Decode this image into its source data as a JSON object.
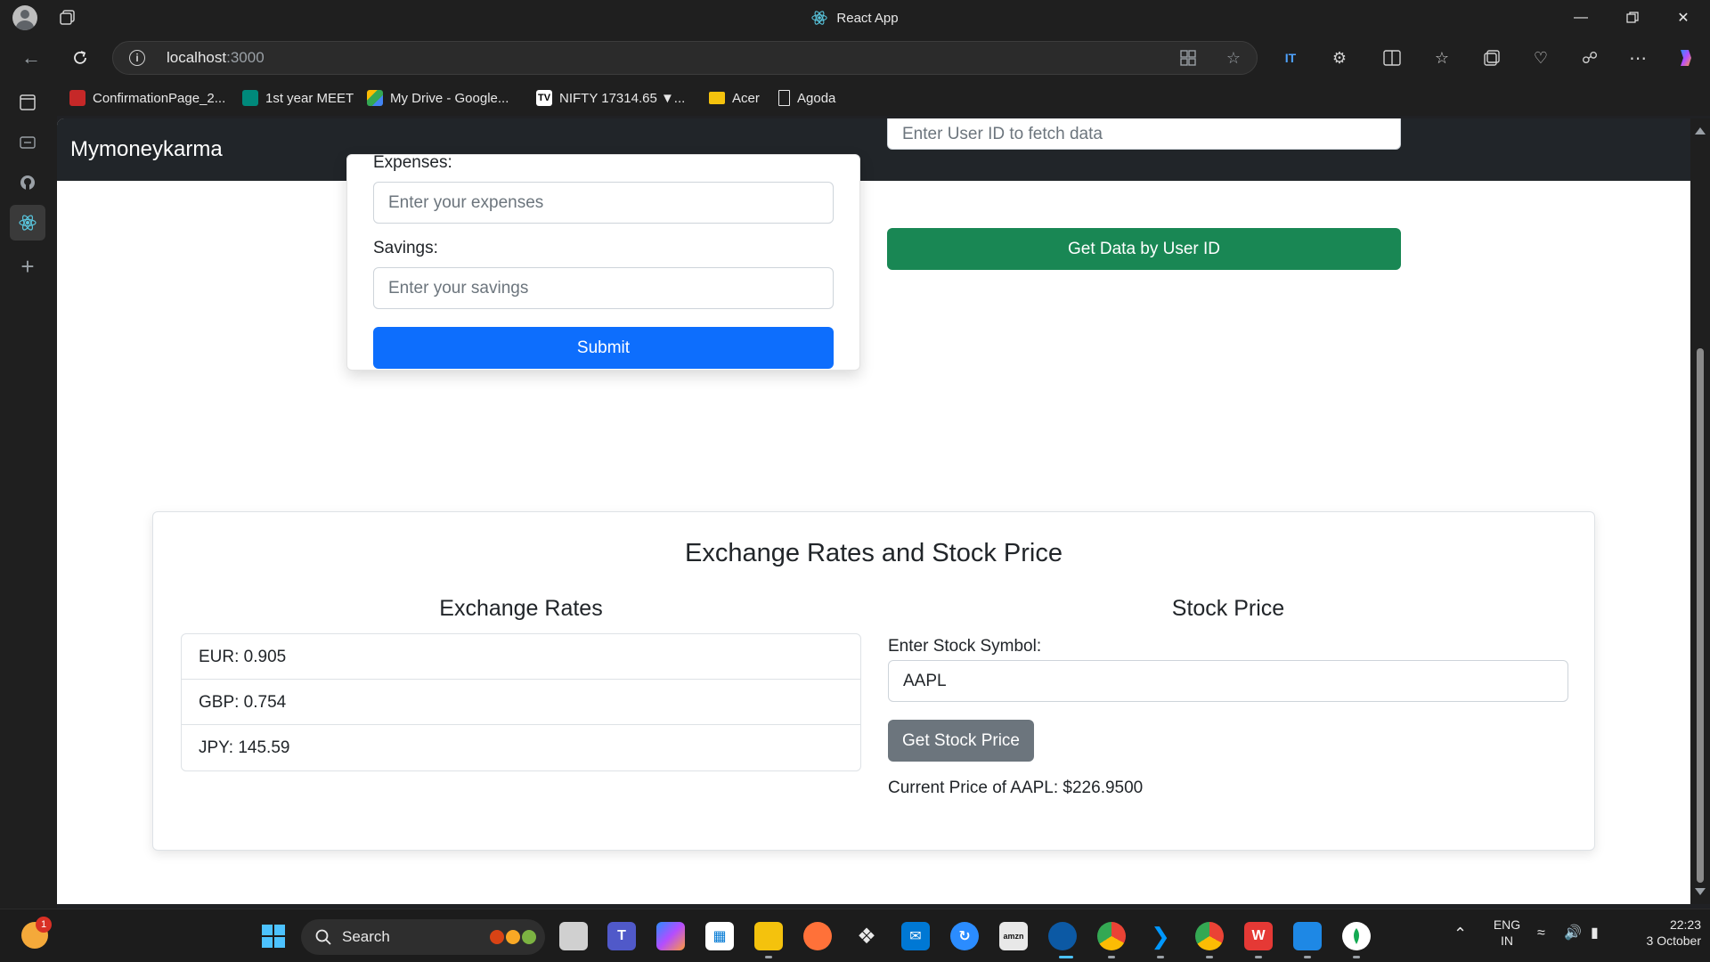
{
  "window": {
    "title": "React App"
  },
  "address_bar": {
    "url_host": "localhost",
    "url_port": ":3000"
  },
  "bookmarks": [
    {
      "label": "ConfirmationPage_2...",
      "icon": "pdf-icon",
      "color": "#c62828"
    },
    {
      "label": "1st year MEET",
      "icon": "meet-icon",
      "color": "#00897b"
    },
    {
      "label": "My Drive - Google...",
      "icon": "google-drive-icon",
      "color": "#fbbc04"
    },
    {
      "label": "NIFTY 17314.65 ▼...",
      "icon": "tradingview-icon",
      "color": "#ffffff"
    },
    {
      "label": "Acer",
      "icon": "folder-icon",
      "color": "#f4c20d"
    },
    {
      "label": "Agoda",
      "icon": "page-icon",
      "color": "#e8e8e8"
    }
  ],
  "app": {
    "brand": "Mymoneykarma",
    "form": {
      "expenses_label": "Expenses:",
      "expenses_placeholder": "Enter your expenses",
      "savings_label": "Savings:",
      "savings_placeholder": "Enter your savings",
      "submit_label": "Submit"
    },
    "fetch": {
      "userid_placeholder": "Enter User ID to fetch data",
      "button_label": "Get Data by User ID"
    },
    "rates_section": {
      "title": "Exchange Rates and Stock Price",
      "exchange_title": "Exchange Rates",
      "rates": [
        "EUR: 0.905",
        "GBP: 0.754",
        "JPY: 145.59"
      ],
      "stock_title": "Stock Price",
      "symbol_label": "Enter Stock Symbol:",
      "symbol_value": "AAPL",
      "get_price_label": "Get Stock Price",
      "current_price": "Current Price of AAPL: $226.9500"
    }
  },
  "taskbar": {
    "search_label": "Search",
    "notification_count": "1",
    "language": "ENG",
    "region": "IN",
    "time": "22:23",
    "date": "3 October"
  },
  "colors": {
    "primary": "#0d6efd",
    "success": "#198754",
    "secondary": "#6c757d",
    "navbar": "#212529"
  }
}
